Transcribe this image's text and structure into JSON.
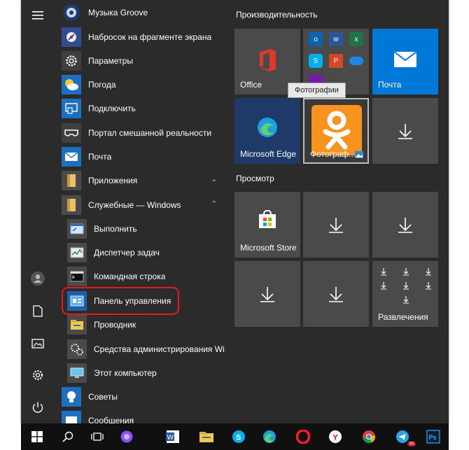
{
  "colors": {
    "menu_bg": "#2b2b2b",
    "tile_gray": "#4a4a4a",
    "accent_blue": "#0078d7",
    "ok_orange": "#f7931e",
    "highlight_red": "#e31b1b"
  },
  "rail": {
    "icons": [
      "hamburger-icon",
      "user-icon",
      "document-icon",
      "pictures-icon",
      "settings-icon",
      "power-icon"
    ]
  },
  "apps": [
    {
      "label": "Музыка Groove",
      "icon": "groove-music-icon"
    },
    {
      "label": "Набросок на фрагменте экрана",
      "icon": "snip-sketch-icon"
    },
    {
      "label": "Параметры",
      "icon": "settings-icon"
    },
    {
      "label": "Погода",
      "icon": "weather-icon"
    },
    {
      "label": "Подключить",
      "icon": "connect-icon"
    },
    {
      "label": "Портал смешанной реальности",
      "icon": "mixed-reality-icon"
    },
    {
      "label": "Почта",
      "icon": "mail-icon"
    },
    {
      "label": "Приложения",
      "icon": "folder-icon",
      "chevron": "⌄"
    },
    {
      "label": "Служебные — Windows",
      "icon": "folder-icon",
      "chevron": "⌃"
    },
    {
      "label": "Выполнить",
      "icon": "run-icon"
    },
    {
      "label": "Диспетчер задач",
      "icon": "task-manager-icon"
    },
    {
      "label": "Командная строка",
      "icon": "cmd-icon"
    },
    {
      "label": "Панель управления",
      "icon": "control-panel-icon"
    },
    {
      "label": "Проводник",
      "icon": "explorer-icon"
    },
    {
      "label": "Средства администрирования Wi...",
      "icon": "admin-tools-icon"
    },
    {
      "label": "Этот компьютер",
      "icon": "this-pc-icon"
    },
    {
      "label": "Советы",
      "icon": "tips-icon"
    },
    {
      "label": "Сообщения",
      "icon": "messages-icon"
    }
  ],
  "tiles": {
    "group1": "Производительность",
    "group2": "Просмотр",
    "office": "Office",
    "mail": "Почта",
    "edge": "Microsoft Edge",
    "photos": "Фотограф...",
    "store": "Microsoft Store",
    "entertainment": "Развлечения",
    "tooltip": "Фотографии"
  },
  "taskbar": {
    "icons": [
      "windows-start-icon",
      "search-icon",
      "task-view-icon",
      "cortana-icon",
      "word-icon",
      "explorer-icon",
      "skype-icon",
      "edge-icon",
      "opera-icon",
      "yandex-icon",
      "chrome-icon",
      "telegram-icon",
      "photoshop-icon"
    ],
    "telegram_badge": "95"
  }
}
